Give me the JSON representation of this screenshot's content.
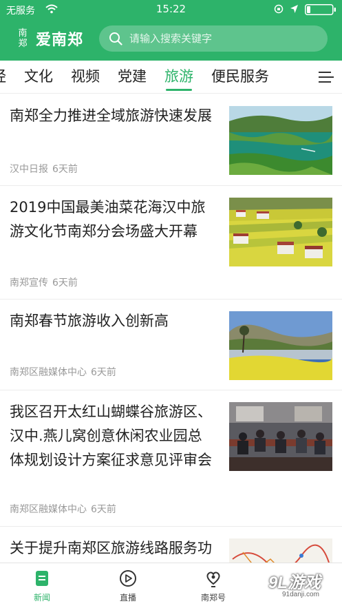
{
  "status_bar": {
    "carrier": "无服务",
    "time": "15:22"
  },
  "header": {
    "logo_seal_top": "南",
    "logo_seal_bottom": "郑",
    "app_name": "爱南郑",
    "search_placeholder": "请输入搜索关键字",
    "accent_color": "#2db36a"
  },
  "tabs": [
    {
      "label": "经"
    },
    {
      "label": "文化"
    },
    {
      "label": "视频"
    },
    {
      "label": "党建"
    },
    {
      "label": "旅游",
      "active": true
    },
    {
      "label": "便民服务"
    }
  ],
  "news": [
    {
      "title": "南郑全力推进全域旅游快速发展",
      "source": "汉中日报",
      "time": "6天前",
      "image": "lake-landscape"
    },
    {
      "title": "2019中国最美油菜花海汉中旅游文化节南郑分会场盛大开幕",
      "source": "南郑宣传",
      "time": "6天前",
      "image": "rapeseed-village"
    },
    {
      "title": "南郑春节旅游收入创新高",
      "source": "南郑区融媒体中心",
      "time": "6天前",
      "image": "rapeseed-river"
    },
    {
      "title": "我区召开太红山蝴蝶谷旅游区、汉中.燕儿窝创意休闲农业园总体规划设计方案征求意见评审会",
      "source": "南郑区融媒体中心",
      "time": "6天前",
      "image": "meeting-room"
    },
    {
      "title": "关于提升南郑区旅游线路服务功能的建议",
      "source": "",
      "time": "",
      "image": "route-map"
    }
  ],
  "bottom_nav": [
    {
      "label": "新闻",
      "icon": "news-icon",
      "active": true
    },
    {
      "label": "直播",
      "icon": "play-icon"
    },
    {
      "label": "南郑号",
      "icon": "heart-person-icon"
    }
  ],
  "watermark": {
    "big": "9L游戏",
    "small": "91danji.com"
  }
}
